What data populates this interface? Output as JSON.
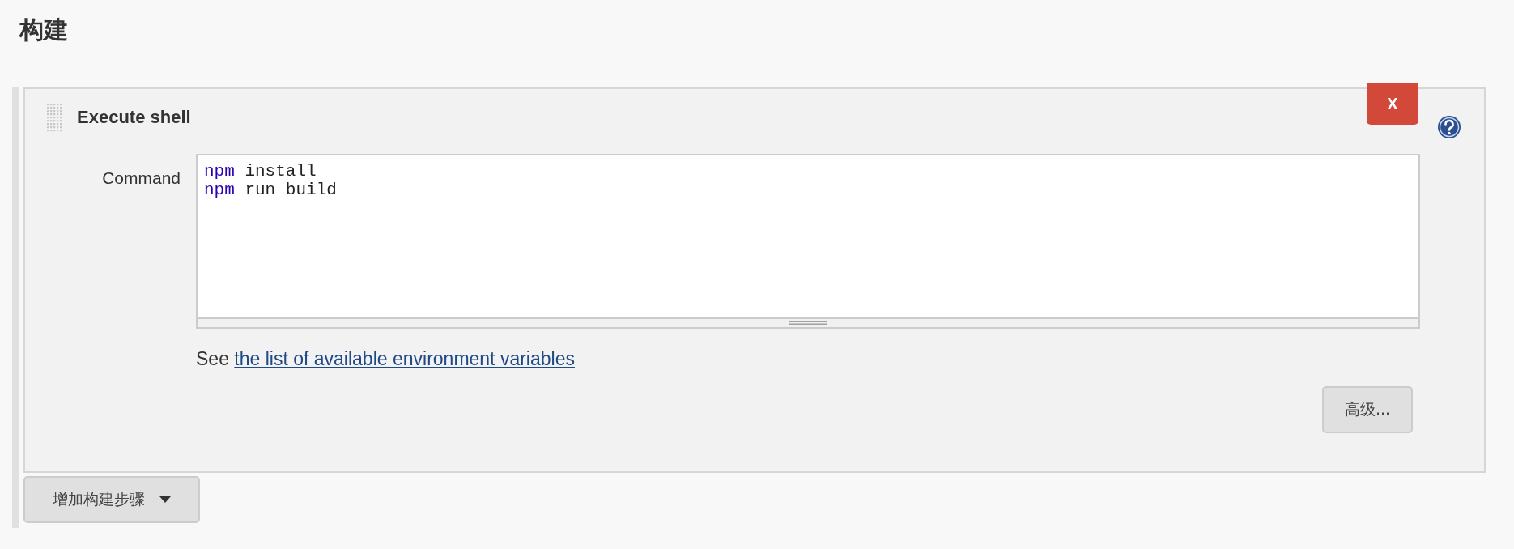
{
  "heading": "构建",
  "step": {
    "title": "Execute shell",
    "delete_label": "X",
    "command_label": "Command",
    "command_lines": [
      [
        {
          "kind": "keyword",
          "text": "npm"
        },
        {
          "kind": "plain",
          "text": " install"
        }
      ],
      [
        {
          "kind": "keyword",
          "text": "npm"
        },
        {
          "kind": "plain",
          "text": " run build"
        }
      ]
    ],
    "hint_prefix": "See",
    "hint_link": "the list of available environment variables",
    "advanced_button": "高级..."
  },
  "add_step_button": "增加构建步骤"
}
